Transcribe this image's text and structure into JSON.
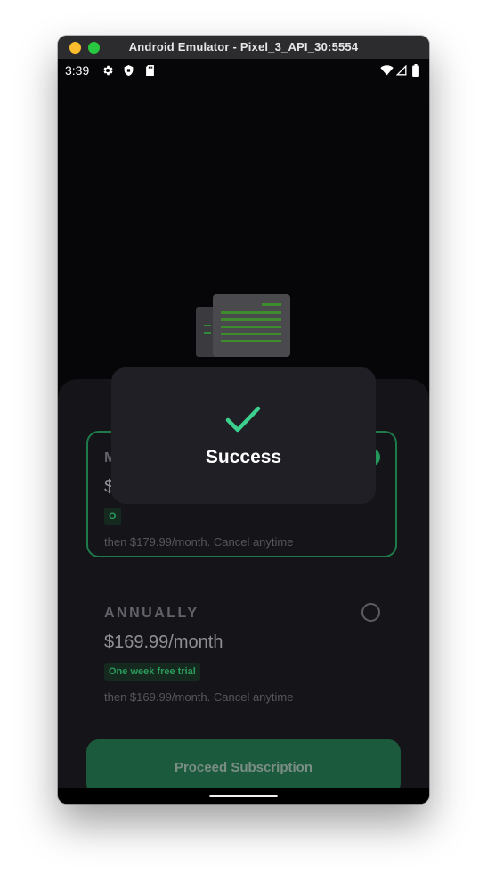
{
  "window": {
    "title": "Android Emulator - Pixel_3_API_30:5554"
  },
  "statusbar": {
    "time": "3:39",
    "left_icons": [
      "gear-icon",
      "shield-icon",
      "sd-card-icon"
    ],
    "right_icons": [
      "wifi-icon",
      "signal-icon",
      "battery-icon"
    ]
  },
  "plans": [
    {
      "name": "M",
      "price": "$",
      "trial_badge": "O",
      "note": "then $179.99/month. Cancel anytime",
      "selected": true
    },
    {
      "name": "ANNUALLY",
      "price": "$169.99/month",
      "trial_badge": "One week free trial",
      "note": "then $169.99/month. Cancel anytime",
      "selected": false
    }
  ],
  "proceed_button": {
    "label": "Proceed Subscription"
  },
  "toast": {
    "message": "Success",
    "icon": "check-icon"
  },
  "colors": {
    "accent": "#22985a",
    "button": "#1c5a3e",
    "sheet": "#151519",
    "toast": "#1f1f25"
  }
}
